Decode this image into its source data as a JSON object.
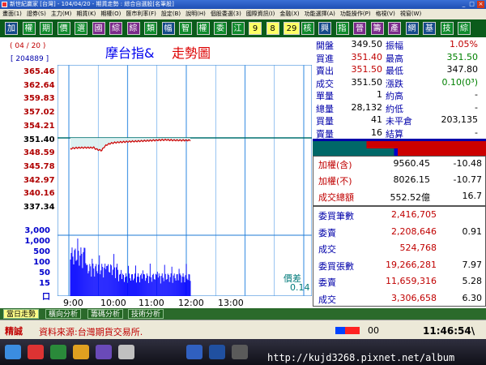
{
  "window": {
    "title": "新世紀贏家 [台灣] - 104/04/20 - 期貨走勢 : 綜合自選股[名筆股]",
    "min": "_",
    "max": "□",
    "close": "×"
  },
  "menu": [
    "畫面(1)",
    "證券(S)",
    "主力(M)",
    "期貨(K)",
    "期權(O)",
    "匯市利率(F)",
    "設定(B)",
    "說明(H)",
    "個股委選(3)",
    "國際資訊(I)",
    "金融(X)",
    "功能選擇(A)",
    "功能操作(P)",
    "格視(V)",
    "視窗(W)"
  ],
  "toolbar": [
    "加",
    "權",
    "期",
    "價",
    "選",
    "國",
    "綜",
    "綜",
    "類",
    "幅",
    "智",
    "權",
    "委",
    "江",
    "9",
    "8",
    "29",
    "核",
    "興",
    "指",
    "晉",
    "籌",
    "產",
    "網",
    "基",
    "技",
    "綜"
  ],
  "chart": {
    "date": "( 04 / 20 )",
    "code": "[ 204889 ]",
    "title_main": "摩台指&",
    "title_sub": "走勢圖",
    "price_ticks": [
      "365.46",
      "362.64",
      "359.83",
      "357.02",
      "354.21",
      "351.40",
      "348.59",
      "345.78",
      "342.97",
      "340.16",
      "337.34"
    ],
    "volume_ticks": [
      "3,000",
      "1,000",
      "500",
      "100",
      "50",
      "15",
      "口"
    ],
    "time_ticks": [
      "9:00",
      "10:00",
      "11:00",
      "12:00",
      "13:00"
    ],
    "diff_label": "價差",
    "diff_value": "0.14"
  },
  "quote": {
    "rows": [
      {
        "l1": "開盤",
        "v1": "349.50",
        "l2": "振幅",
        "v2": "1.05%"
      },
      {
        "l1": "買進",
        "v1": "351.40",
        "l2": "最高",
        "v2": "351.50"
      },
      {
        "l1": "賣出",
        "v1": "351.50",
        "l2": "最低",
        "v2": "347.80"
      },
      {
        "l1": "成交",
        "v1": "351.50",
        "l2": "漲跌",
        "v2": "0.10(0³)"
      },
      {
        "l1": "單量",
        "v1": "1",
        "l2": "約高",
        "v2": "-"
      },
      {
        "l1": "總量",
        "v1": "28,132",
        "l2": "約低",
        "v2": "-"
      },
      {
        "l1": "買量",
        "v1": "41",
        "l2": "未平倉",
        "v2": "203,135"
      },
      {
        "l1": "賣量",
        "v1": "16",
        "l2": "結算",
        "v2": "-"
      }
    ]
  },
  "futures": {
    "rows": [
      {
        "label": "加權(含)",
        "value": "9560.45",
        "diff": "-10.48"
      },
      {
        "label": "加權(不)",
        "value": "8026.15",
        "diff": "-10.77"
      },
      {
        "label": "成交總額",
        "value": "552.52億",
        "diff": "16.7"
      }
    ]
  },
  "orders": {
    "rows": [
      {
        "label": "委買筆數",
        "value": "2,416,705",
        "diff": ""
      },
      {
        "label": "委賣",
        "value": "2,208,646",
        "diff": "0.91"
      },
      {
        "label": "成交",
        "value": "524,768",
        "diff": ""
      },
      {
        "label": "委買張數",
        "value": "19,266,281",
        "diff": "7.97"
      },
      {
        "label": "委賣",
        "value": "11,659,316",
        "diff": "5.28"
      },
      {
        "label": "成交",
        "value": "3,306,658",
        "diff": "6.30"
      }
    ]
  },
  "tabs": [
    "當日走勢",
    "橫向分析",
    "籌碼分析",
    "技術分析"
  ],
  "status": {
    "label": "精誠",
    "message": "資料來源:台灣期貨交易所.",
    "count": "00",
    "clock": "11:46:54\\"
  },
  "taskbar": {
    "url": "http://kujd3268.pixnet.net/album"
  },
  "colors": {
    "background": "#ffffff",
    "grid": "#1e7ad6",
    "price_line": "#cc0000",
    "reference_line": "#007070",
    "volume": "#0000ff",
    "toolbar": "#0b5b1b"
  }
}
